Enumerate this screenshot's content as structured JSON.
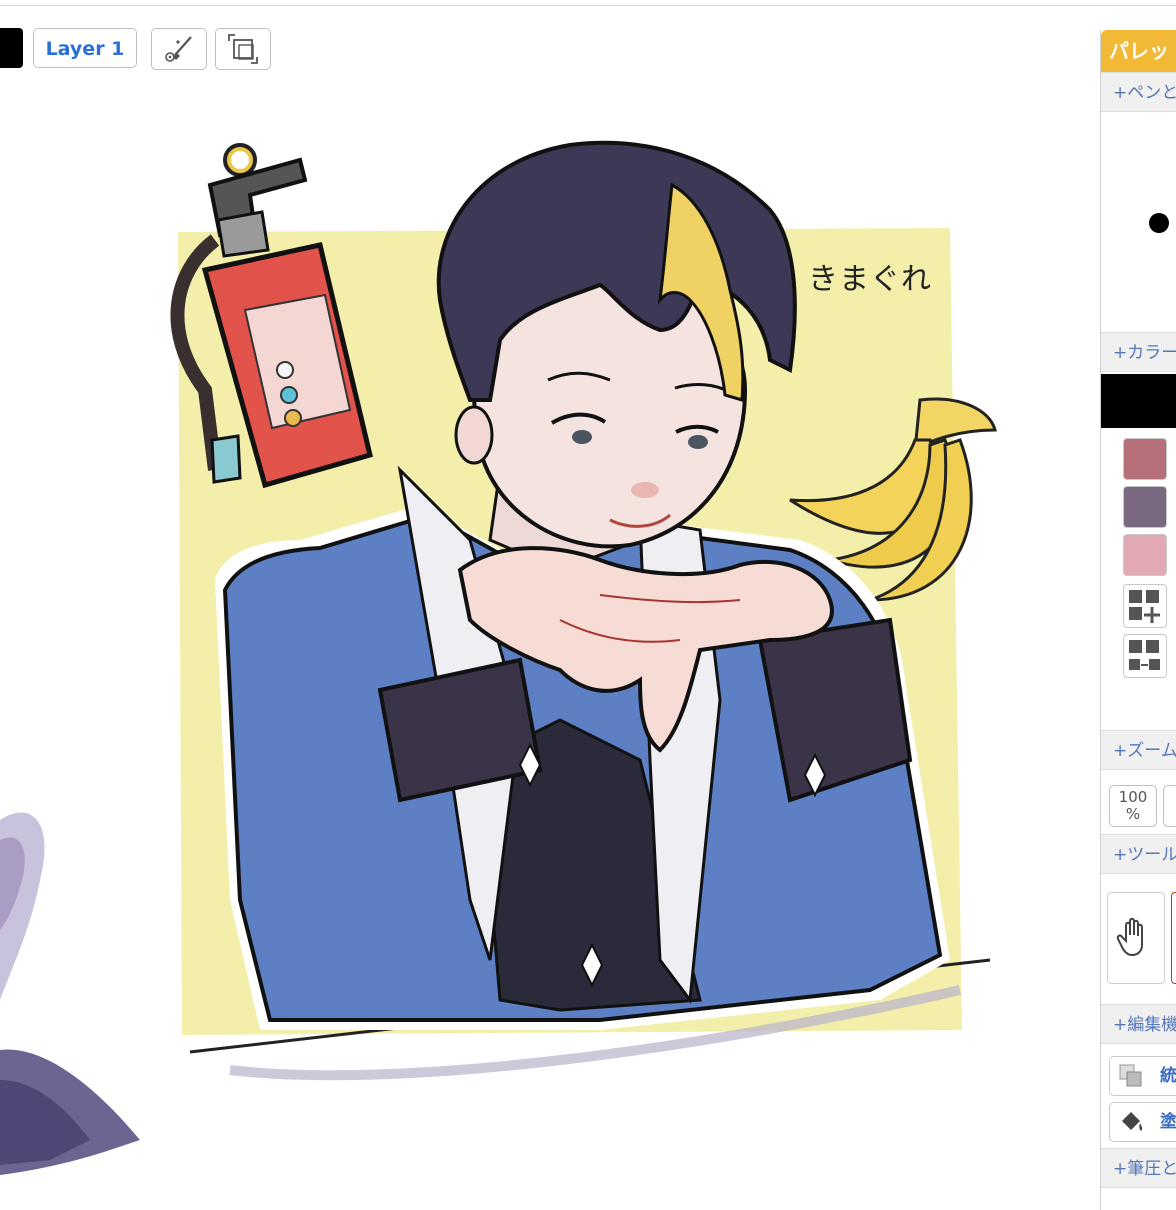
{
  "toolbar": {
    "current_color": "#000000",
    "layer_label": "Layer 1",
    "tool_settings_icon": "brush-settings-icon",
    "transform_icon": "transform-icon"
  },
  "canvas": {
    "signature": "きまぐれ"
  },
  "palette_panel": {
    "title": "パレッ",
    "sections": {
      "pen": "+ペンと",
      "color": "+カラー",
      "zoom": "+ズーム",
      "tools": "+ツール",
      "edit": "+編集機",
      "pressure": "+筆圧と"
    },
    "current_color": "#000000",
    "swatches": [
      "#b5707a",
      "#7a6880",
      "#e0a9b4"
    ],
    "zoom_value": "100",
    "zoom_unit": "%",
    "edit_buttons": [
      "統",
      "塗"
    ]
  }
}
